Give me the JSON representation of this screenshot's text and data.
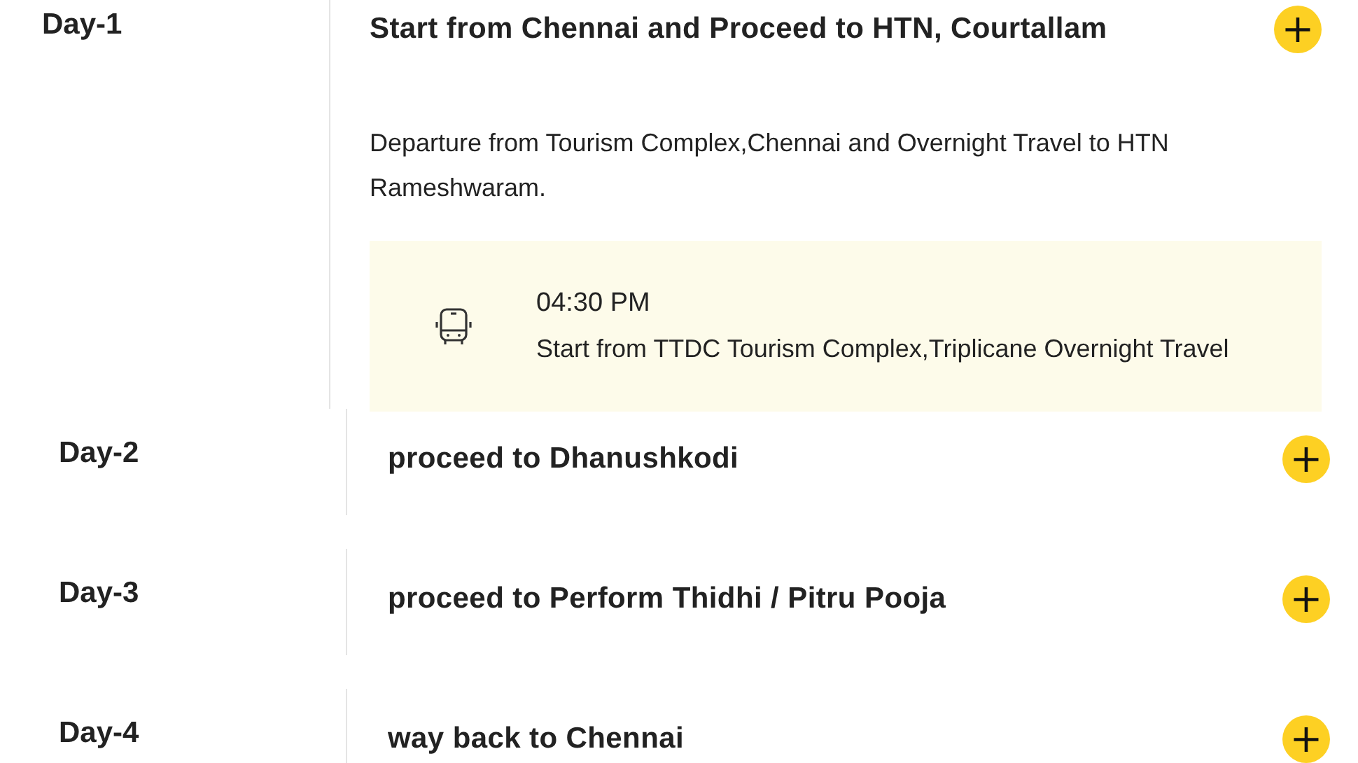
{
  "days": [
    {
      "label": "Day-1",
      "title": "Start from Chennai and Proceed to HTN, Courtallam",
      "toggle": "+",
      "expanded": true,
      "description": "Departure from Tourism Complex,Chennai and Overnight Travel to HTN Rameshwaram.",
      "events": [
        {
          "time": "04:30 PM",
          "text": "Start from TTDC Tourism Complex,Triplicane Overnight Travel"
        }
      ]
    },
    {
      "label": "Day-2",
      "title": "proceed to Dhanushkodi",
      "toggle": "+",
      "expanded": false
    },
    {
      "label": "Day-3",
      "title": "proceed to Perform Thidhi / Pitru Pooja",
      "toggle": "+",
      "expanded": false
    },
    {
      "label": "Day-4",
      "title": "way back to Chennai",
      "toggle": "+",
      "expanded": false
    }
  ]
}
